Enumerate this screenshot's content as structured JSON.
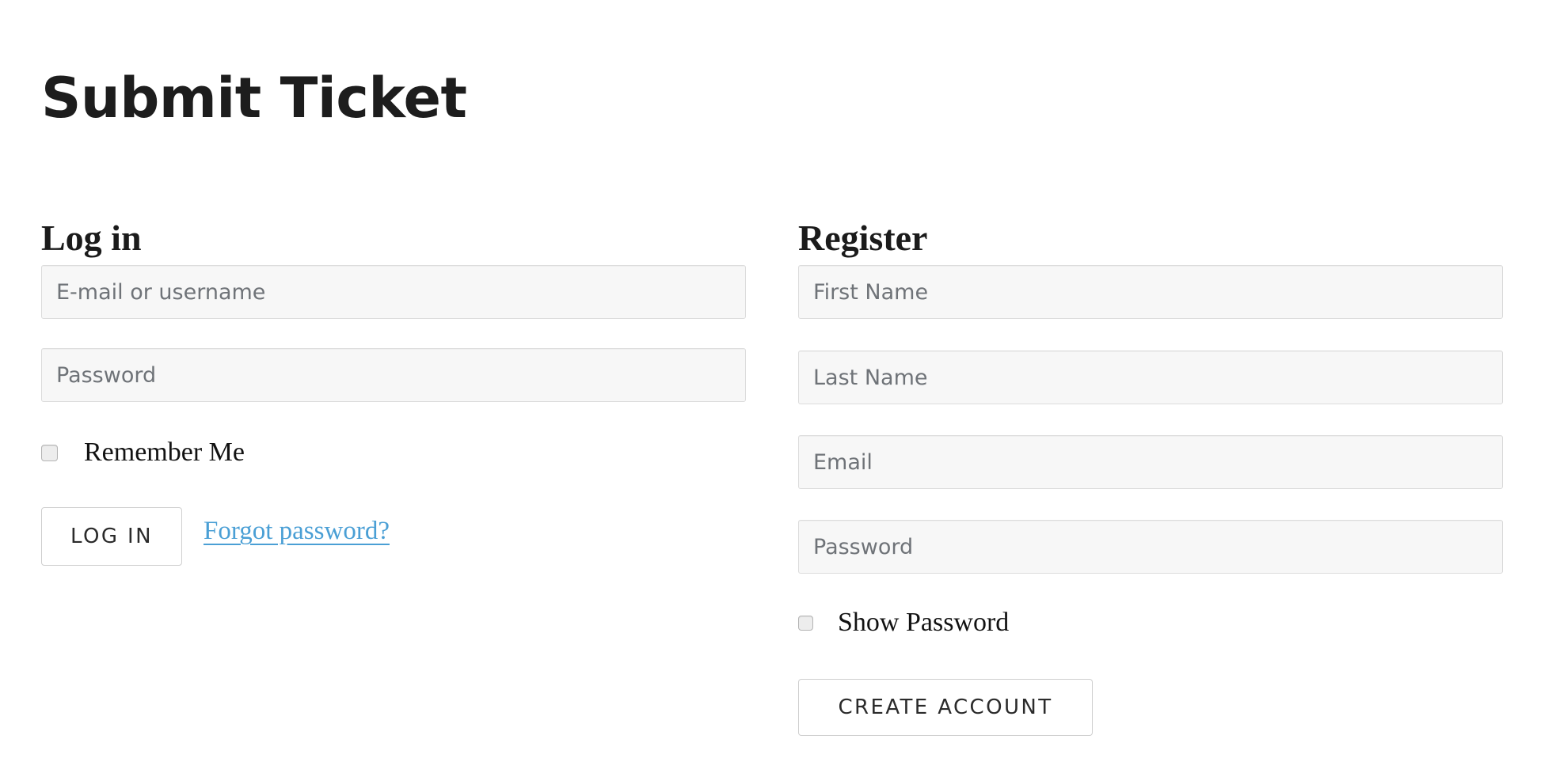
{
  "page": {
    "title": "Submit Ticket",
    "background_color": "#ffffff",
    "link_color": "#4a9fd5",
    "text_color": "#1d1d1d"
  },
  "login": {
    "heading": "Log in",
    "fields": [
      {
        "name": "username",
        "placeholder": "E-mail or username",
        "value": "",
        "type": "text"
      },
      {
        "name": "password",
        "placeholder": "Password",
        "value": "",
        "type": "password"
      }
    ],
    "remember_me": {
      "label": "Remember Me",
      "checked": false
    },
    "submit_label": "LOG IN",
    "forgot_password_label": "Forgot password?"
  },
  "register": {
    "heading": "Register",
    "fields": [
      {
        "name": "first-name",
        "placeholder": "First Name",
        "value": "",
        "type": "text"
      },
      {
        "name": "last-name",
        "placeholder": "Last Name",
        "value": "",
        "type": "text"
      },
      {
        "name": "email",
        "placeholder": "Email",
        "value": "",
        "type": "text"
      },
      {
        "name": "password",
        "placeholder": "Password",
        "value": "",
        "type": "password"
      }
    ],
    "show_password": {
      "label": "Show Password",
      "checked": false
    },
    "submit_label": "CREATE ACCOUNT"
  }
}
